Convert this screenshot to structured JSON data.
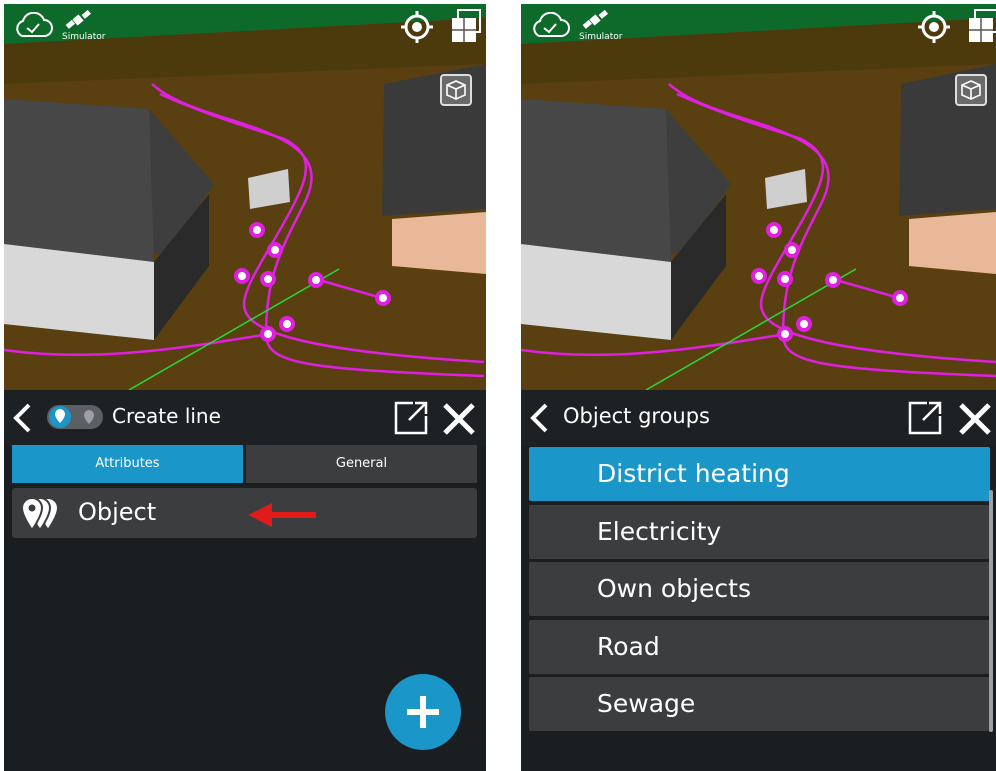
{
  "left_screen": {
    "simulator_label": "Simulator",
    "header": {
      "title": "Create line"
    },
    "tabs": [
      {
        "label": "Attributes",
        "active": true
      },
      {
        "label": "General",
        "active": false
      }
    ],
    "items": [
      {
        "label": "Object"
      }
    ],
    "icons": [
      "cloud-sync-icon",
      "satellite-icon",
      "gps-target-icon",
      "layers-icon",
      "3d-cube-icon",
      "back-chevron-icon",
      "line-mode-toggle-icon",
      "open-external-icon",
      "close-icon",
      "object-pins-icon",
      "red-arrow-annotation",
      "add-icon"
    ]
  },
  "right_screen": {
    "simulator_label": "Simulator",
    "header": {
      "title": "Object groups"
    },
    "groups": [
      {
        "label": "District heating",
        "selected": true
      },
      {
        "label": "Electricity",
        "selected": false
      },
      {
        "label": "Own objects",
        "selected": false
      },
      {
        "label": "Road",
        "selected": false
      },
      {
        "label": "Sewage",
        "selected": false
      }
    ]
  },
  "colors": {
    "accent": "#1a96c8",
    "line": "#e020e0",
    "panel": "#1b1e20",
    "item": "#3c3d3e",
    "annotation": "#e01b1b"
  }
}
